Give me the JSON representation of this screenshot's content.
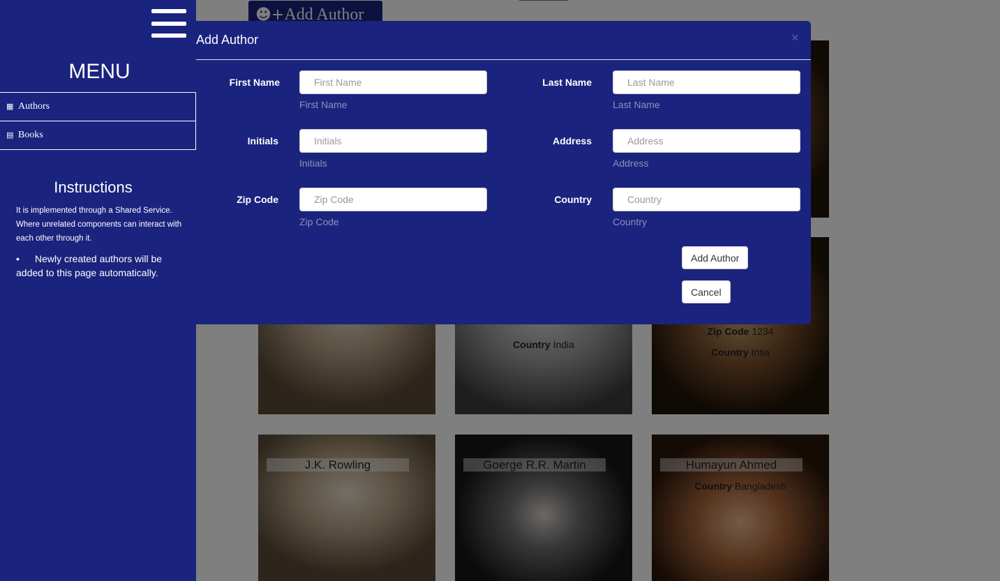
{
  "sidebar": {
    "menu_title": "MENU",
    "items": [
      {
        "label": "Authors",
        "icon": "address-book-icon"
      },
      {
        "label": "Books",
        "icon": "book-icon"
      }
    ],
    "instructions": {
      "title": "Instructions",
      "paragraph": "It is implemented through a Shared Service. Where unrelated components can interact with each other through it.",
      "bullet": "Newly created authors will be added to this page automatically."
    }
  },
  "background": {
    "add_author_button": "Add Author",
    "cards": [
      {
        "name": "",
        "meta": []
      },
      {
        "name": "",
        "meta": []
      },
      {
        "name": "",
        "meta": []
      },
      {
        "name": "",
        "meta": [
          {
            "label": "Country",
            "value": "India"
          }
        ]
      },
      {
        "name": "",
        "meta": [
          {
            "label": "Zip Code",
            "value": "1234"
          },
          {
            "label": "Country",
            "value": "Intia"
          }
        ]
      },
      {
        "name": "",
        "meta": []
      },
      {
        "name": "J.K. Rowling",
        "meta": []
      },
      {
        "name": "Goerge R.R. Martin",
        "meta": []
      },
      {
        "name": "Humayun Ahmed",
        "meta": [
          {
            "label": "Country",
            "value": "Bangladesh"
          }
        ]
      }
    ]
  },
  "modal": {
    "title": "Add Author",
    "close": "×",
    "fields": {
      "first_name": {
        "label": "First Name",
        "placeholder": "First Name",
        "help": "First Name",
        "value": ""
      },
      "last_name": {
        "label": "Last Name",
        "placeholder": "Last Name",
        "help": "Last Name",
        "value": ""
      },
      "initials": {
        "label": "Initials",
        "placeholder": "Initials",
        "help": "Initials",
        "value": ""
      },
      "address": {
        "label": "Address",
        "placeholder": "Address",
        "help": "Address",
        "value": ""
      },
      "zip_code": {
        "label": "Zip Code",
        "placeholder": "Zip Code",
        "help": "Zip Code",
        "value": ""
      },
      "country": {
        "label": "Country",
        "placeholder": "Country",
        "help": "Country",
        "value": ""
      }
    },
    "submit_label": "Add Author",
    "cancel_label": "Cancel"
  },
  "colors": {
    "primary": "#1a237e",
    "overlay": "rgba(0,0,0,0.5)",
    "help_text": "#8c92b8"
  }
}
